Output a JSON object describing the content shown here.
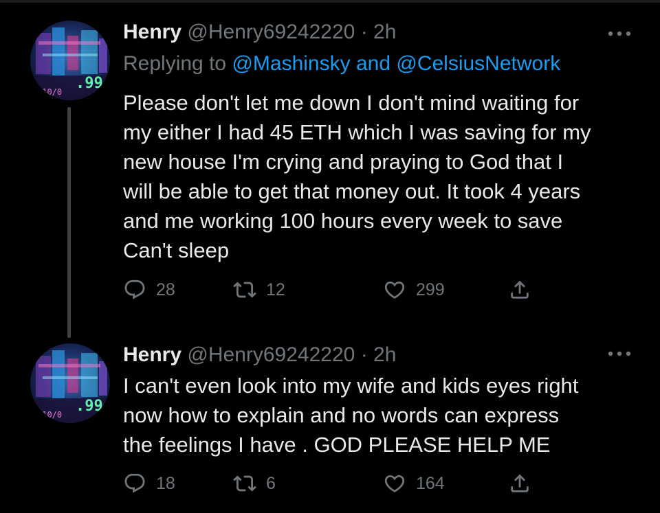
{
  "tweets": [
    {
      "author_name": "Henry",
      "author_handle": "@Henry69242220",
      "separator": "·",
      "time": "2h",
      "reply_prefix": "Replying to",
      "reply_mention_1": "@Mashinsky",
      "reply_conjunction": "and",
      "reply_mention_2": "@CelsiusNetwork",
      "text": "Please don't let me down I don't mind waiting for\nmy either I had 45 ETH which I was saving for my\nnew house I'm crying and praying to God that I\nwill be able to get that money out. It took 4 years\nand me working 100 hours every week to save\nCan't sleep",
      "replies": "28",
      "retweets": "12",
      "likes": "299"
    },
    {
      "author_name": "Henry",
      "author_handle": "@Henry69242220",
      "separator": "·",
      "time": "2h",
      "text": "I can't even look into my wife and kids eyes right\nnow how to explain and no words can express\nthe feelings I have . GOD PLEASE HELP ME",
      "replies": "18",
      "retweets": "6",
      "likes": "164"
    }
  ],
  "icons": {
    "reply": "reply-icon",
    "retweet": "retweet-icon",
    "like": "heart-icon",
    "share": "share-icon",
    "more": "more-icon"
  },
  "colors": {
    "background": "#000000",
    "text_primary": "#e7e9ea",
    "text_secondary": "#71767b",
    "link": "#1d9bf0",
    "thread_line": "#3e4144"
  }
}
